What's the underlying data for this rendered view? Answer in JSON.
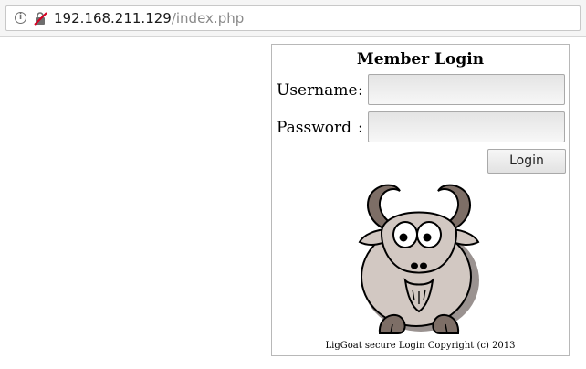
{
  "browser": {
    "url_host": "192.168.211.129",
    "url_path": "/index.php",
    "info_glyph": "i",
    "icons": [
      "info-icon",
      "insecure-connection-icon"
    ]
  },
  "login": {
    "title": "Member Login",
    "username_label": "Username",
    "password_label": "Password",
    "colon": ":",
    "username_value": "",
    "password_value": "",
    "button_label": "Login",
    "copyright": "LigGoat secure Login Copyright (c) 2013"
  },
  "colors": {
    "goat_fur": "#d2c8c2",
    "goat_shadow": "#9a9290",
    "horns_hooves": "#7d6e66",
    "input_bg": "#ececec"
  }
}
